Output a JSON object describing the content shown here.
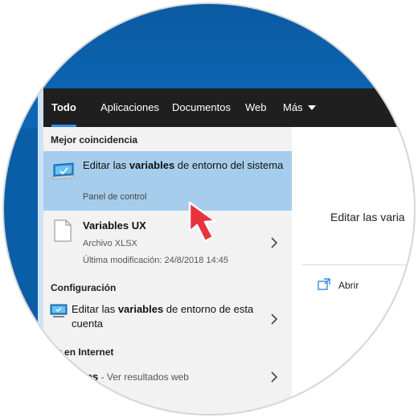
{
  "tabs": {
    "items": [
      {
        "label": "Todo"
      },
      {
        "label": "Aplicaciones"
      },
      {
        "label": "Documentos"
      },
      {
        "label": "Web"
      },
      {
        "label": "Más"
      }
    ]
  },
  "sections": {
    "best_match": "Mejor coincidencia",
    "settings": "Configuración",
    "web": "rcar en Internet"
  },
  "best_match": {
    "title_pre": "Editar las ",
    "title_bold": "variables",
    "title_post": " de entorno del sistema",
    "subtitle": "Panel de control",
    "icon": "control-panel-monitor-icon"
  },
  "file_result": {
    "title": "Variables UX",
    "type": "Archivo XLSX",
    "modified": "Última modificación: 24/8/2018 14:45",
    "icon": "file-icon"
  },
  "settings_result": {
    "title_pre": "Editar las ",
    "title_bold": "variables",
    "title_post": " de entorno de esta cuenta",
    "icon": "monitor-icon"
  },
  "web_result": {
    "title_bold": "ables",
    "title_post": " - Ver resultados web"
  },
  "preview": {
    "title": "Editar las varia",
    "open_label": "Abrir",
    "icon": "open-window-icon"
  },
  "colors": {
    "tab_bar": "#1f1f1f",
    "accent": "#2e8de6",
    "selection": "#a6cdec",
    "left_panel": "#f2f2f2",
    "arrow": "#e8323c",
    "desktop": "#0a5ea8"
  }
}
